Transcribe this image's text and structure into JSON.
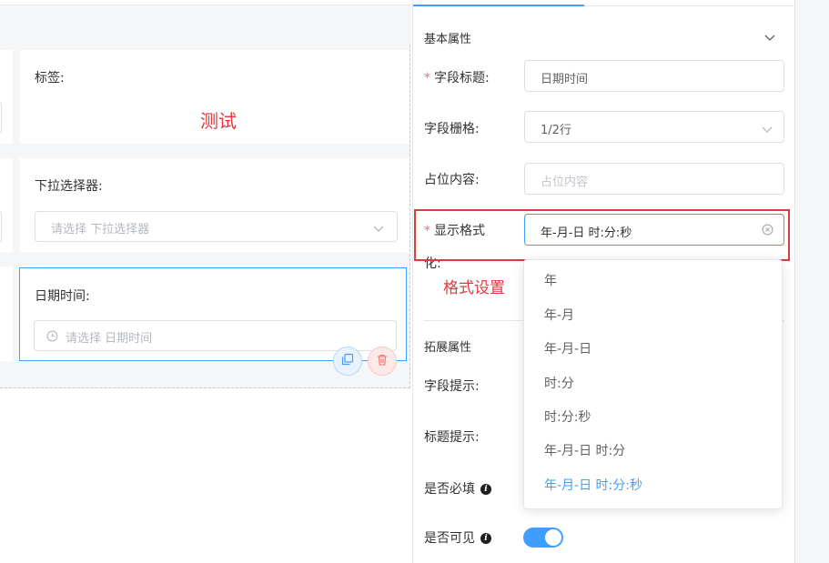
{
  "canvas": {
    "row1_label": "标签:",
    "row1_red_text": "测试",
    "row2_label": "下拉选择器:",
    "row2_placeholder": "请选择 下拉选择器",
    "row3_label": "日期时间:",
    "row3_placeholder": "请选择 日期时间",
    "copy_icon": "copy-icon",
    "delete_icon": "trash-icon"
  },
  "panel": {
    "section_basic": "基本属性",
    "fields": {
      "title_label": "字段标题:",
      "title_value": "日期时间",
      "grid_label": "字段栅格:",
      "grid_value": "1/2行",
      "placeholder_label": "占位内容:",
      "placeholder_hint": "占位内容",
      "format_label_line1": "显示格式",
      "format_label_line2": "化:",
      "format_value": "年-月-日 时:分:秒",
      "format_annotation": "格式设置"
    },
    "section_ext": "拓展属性",
    "ext": {
      "field_tip": "字段提示:",
      "title_tip": "标题提示:",
      "required": "是否必填",
      "visible": "是否可见",
      "visible_on": true
    },
    "colors": {
      "accent": "#409eff",
      "required_star": "#f56c6c",
      "annotation": "#e0393e"
    }
  },
  "dropdown": {
    "options": [
      "年",
      "年-月",
      "年-月-日",
      "时:分",
      "时:分:秒",
      "年-月-日 时:分",
      "年-月-日 时:分:秒"
    ],
    "selected_index": 6
  }
}
